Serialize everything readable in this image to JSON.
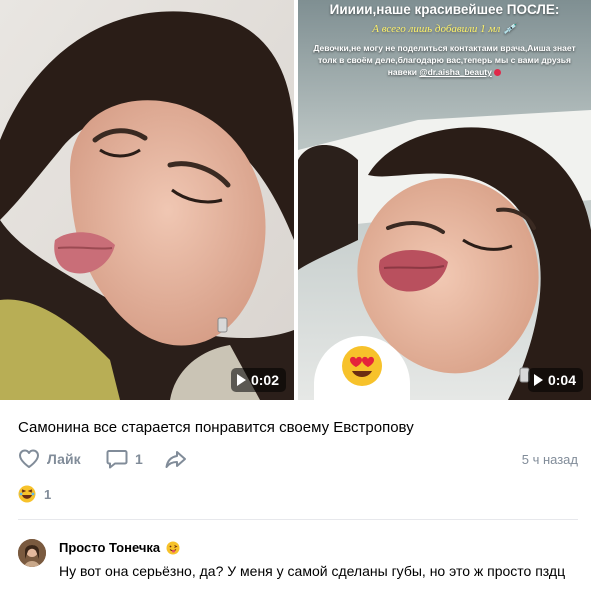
{
  "post": {
    "videos": [
      {
        "duration": "0:02",
        "play_icon": "play-icon"
      },
      {
        "duration": "0:04",
        "play_icon": "play-icon",
        "overlay_title": "Иииии,наше  красивейшее ПОСЛЕ:",
        "overlay_subtitle": "А всего лишь добавили 1 мл",
        "overlay_body": "Девочки,не могу не поделиться контактами врача,Аиша знает толк в своём деле,благодарю вас,теперь мы с вами друзья навеки ",
        "overlay_handle": "@dr.aisha_beauty",
        "sticker_icon": "heart-eyes-emoji"
      }
    ],
    "caption": "Самонина все старается понравится своему Евстропову",
    "actions": {
      "like_label": "Лайк",
      "comment_count": "1",
      "time_ago": "5 ч назад"
    },
    "reactions": {
      "emoji": "laughing-emoji",
      "count": "1"
    }
  },
  "comment": {
    "author": "Просто Тонечка",
    "author_emoji": "tongue-emoji",
    "text": "Ну вот она серьёзно, да? У меня у самой сделаны губы, но это ж просто пздц"
  },
  "colors": {
    "muted": "#818c99",
    "divider": "#e7e8ec",
    "overlay_yellow": "#fff36a"
  }
}
